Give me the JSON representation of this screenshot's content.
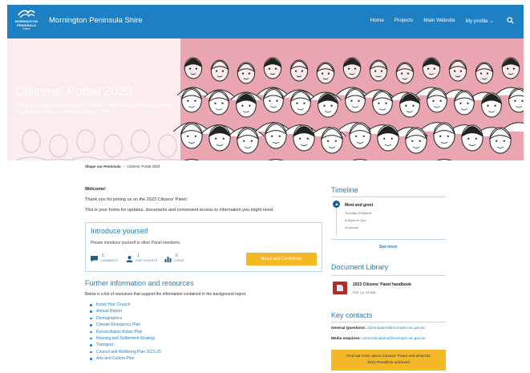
{
  "header": {
    "logo_text": [
      "MORNINGTON",
      "PENINSULA",
      "Shire"
    ],
    "brand": "Mornington Peninsula Shire",
    "nav": [
      "Home",
      "Projects",
      "Main Website",
      "My profile ⌄"
    ],
    "bg_color": "#1e7fc3"
  },
  "hero": {
    "title": "Citizens' Portal 2023",
    "subtitle": "Thank you for participating in the Citizens' Panel and providing us with your thoughts and ideas on the future of our Shire."
  },
  "breadcrumb": {
    "root": "Shape our Peninsula",
    "separator": "|",
    "current": "Citizens' Portal 2023"
  },
  "main": {
    "welcome_heading": "Welcome!",
    "welcome_p1": "Thank you for joining us on the 2023 Citizens' Panel.",
    "welcome_p2": "This is your home for updates, documents and convenient access to information you might need.",
    "introduce": {
      "title": "Introduce yourself",
      "text": "Please introduce yourself to other Panel members.",
      "stats": [
        {
          "count": "0",
          "label": "COMMENTS",
          "icon": "comment-icon"
        },
        {
          "count": "1",
          "label": "PARTICIPANTS",
          "icon": "person-icon"
        },
        {
          "count": "0",
          "label": "VIEWS",
          "icon": "bar-chart-icon"
        }
      ],
      "button": "Read and Contribute",
      "button_color": "#f5b928"
    },
    "further": {
      "heading": "Further information and resources",
      "intro": "Below is a list of resources that support the information contained in the background report.",
      "links": [
        "Know Your Council",
        "Annual Report",
        "Demographics",
        "Climate Emergency Plan",
        "Reconciliation Action Plan",
        "Housing and Settlement Strategy",
        "Transport",
        "Council and Wellbeing Plan 2021-25",
        "Arts and Culture Plan"
      ]
    }
  },
  "sidebar": {
    "timeline": {
      "heading": "Timeline",
      "event_title": "Meet and greet",
      "event_lines": [
        "Tuesday 28 March",
        "5:30pm to 7pm",
        "In-person"
      ],
      "see_more": "See more"
    },
    "documents": {
      "heading": "Document Library",
      "title": "2023 Citizens' Panel handbook",
      "meta": "PDF (11.43 MB)"
    },
    "contacts": {
      "heading": "Key contacts",
      "general_label": "General Questions:",
      "general_email": "citizenspanel@mornpen.vic.gov.au",
      "media_label": "Media enquiries:",
      "media_email": "communications@mornpen.vic.gov.au"
    },
    "cta_line1": "Find out more about Citizens' Panel and what the",
    "cta_line2": "2022 Panellists achieved"
  }
}
